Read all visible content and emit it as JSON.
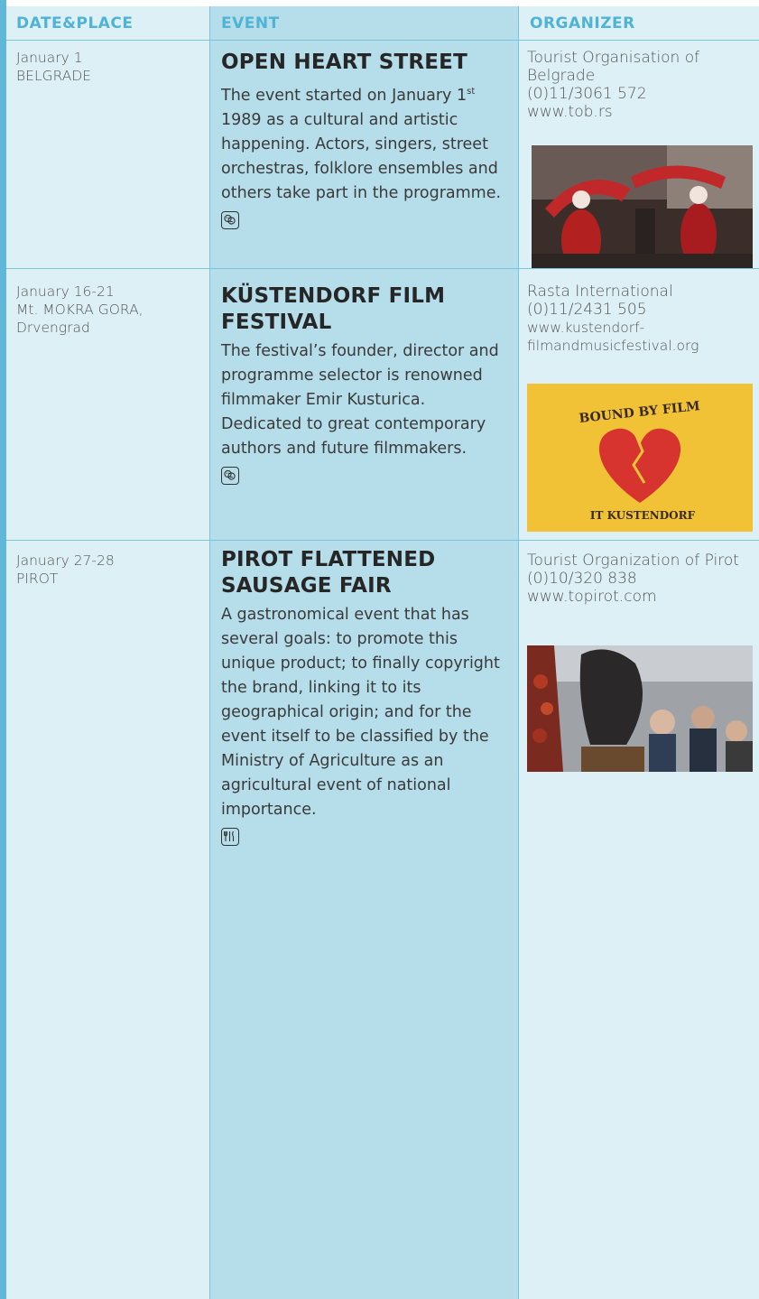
{
  "headers": {
    "date_place": "DATE&PLACE",
    "event": "EVENT",
    "organizer": "ORGANIZER"
  },
  "rows": [
    {
      "date": "January 1",
      "place": "BELGRADE",
      "title": "OPEN HEART STREET",
      "desc_pre": "The event started on January 1",
      "desc_sup": "st",
      "desc_post": " 1989 as a cultural and artistic happening. Actors, singers, street orchestras, folklore ensembles and others take part in the programme.",
      "icon": "theatre-masks-icon",
      "org_name": "Tourist Organisation of Belgrade",
      "org_phone": "(0)11/3061 572",
      "org_web": "www.tob.rs",
      "photo": "santa-parade-photo"
    },
    {
      "date": "January 16-21",
      "place": "Mt. MOKRA GORA, Drvengrad",
      "title": "KÜSTENDORF FILM FESTIVAL",
      "desc": "The festival’s founder, director and programme selector is renowned filmmaker Emir Kusturica. Dedicated to great contemporary authors and future filmmakers.",
      "icon": "theatre-masks-icon",
      "org_name": "Rasta International",
      "org_phone": "(0)11/2431 505",
      "org_web": "www.kustendorf-filmandmusicfestival.org",
      "photo": "bound-by-film-heart-poster",
      "poster_top": "BOUND BY FILM",
      "poster_bottom": "IT KUSTENDORF"
    },
    {
      "date": "January 27-28",
      "place": "PIROT",
      "title": "PIROT FLATTENED SAUSAGE FAIR",
      "desc": "A gastronomical event that has several goals: to promote this unique product; to finally copyright the brand, linking it to its geographical origin; and for the event itself to be classified by the Ministry of Agriculture as an agricultural event of national importance.",
      "icon": "cutlery-icon",
      "org_name": "Tourist Organization of Pirot",
      "org_phone": "(0)10/320 838",
      "org_web": "www.topirot.com",
      "photo": "sausage-fair-crowd-photo"
    }
  ],
  "colors": {
    "accent": "#4fb3d6",
    "event_column": "#b6ddea",
    "side_columns": "#ddf0f6",
    "left_bar": "#5fb8d8"
  }
}
